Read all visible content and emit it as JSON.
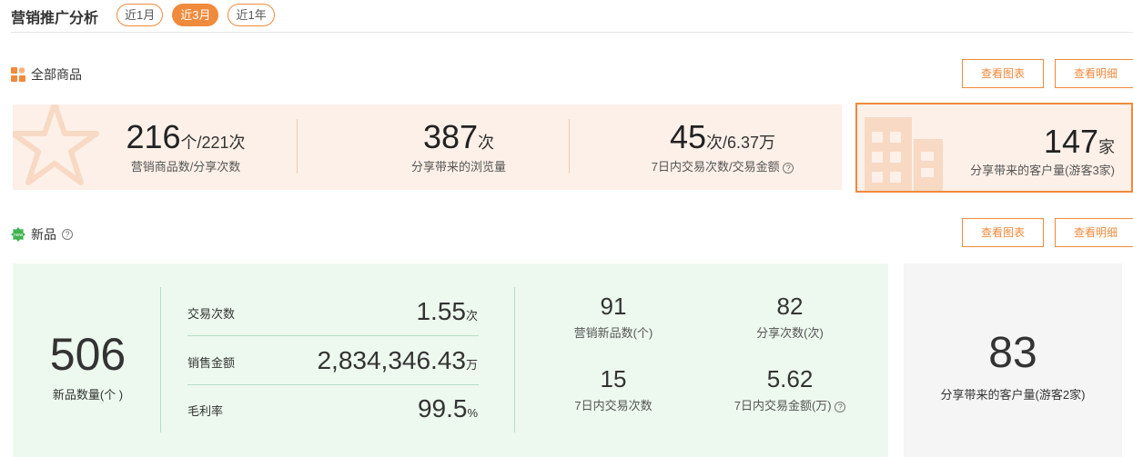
{
  "header": {
    "title": "营销推广分析",
    "tabs": [
      {
        "label": "近1月",
        "active": false
      },
      {
        "label": "近3月",
        "active": true
      },
      {
        "label": "近1年",
        "active": false
      }
    ]
  },
  "colors": {
    "accent": "#f08a3c",
    "peach_bg": "#fdf0e8",
    "green_bg": "#edf9ee",
    "grey_bg": "#f5f5f5"
  },
  "all_products": {
    "title": "全部商品",
    "icon": "grid-icon",
    "buttons": {
      "chart": "查看图表",
      "detail": "查看明细"
    },
    "stats": [
      {
        "value": "216",
        "unit": "个/221次",
        "label": "营销商品数/分享次数"
      },
      {
        "value": "387",
        "unit": "次",
        "label": "分享带来的浏览量"
      },
      {
        "value": "45",
        "unit": "次/6.37万",
        "label": "7日内交易次数/交易金额"
      }
    ],
    "highlight": {
      "value": "147",
      "unit": "家",
      "label": "分享带来的客户量(游客3家)"
    }
  },
  "new_products": {
    "title": "新品",
    "icon": "new-badge-icon",
    "buttons": {
      "chart": "查看图表",
      "detail": "查看明细"
    },
    "count": {
      "value": "506",
      "label": "新品数量(个 )"
    },
    "metrics": [
      {
        "label": "交易次数",
        "value": "1.55",
        "unit": "次"
      },
      {
        "label": "销售金额",
        "value": "2,834,346.43",
        "unit": "万"
      },
      {
        "label": "毛利率",
        "value": "99.5",
        "unit": "%"
      }
    ],
    "grid": [
      {
        "value": "91",
        "label": "营销新品数(个)"
      },
      {
        "value": "82",
        "label": "分享次数(次)"
      },
      {
        "value": "15",
        "label": "7日内交易次数"
      },
      {
        "value": "5.62",
        "label": "7日内交易金额(万)"
      }
    ],
    "customers": {
      "value": "83",
      "label": "分享带来的客户量(游客2家)"
    }
  }
}
